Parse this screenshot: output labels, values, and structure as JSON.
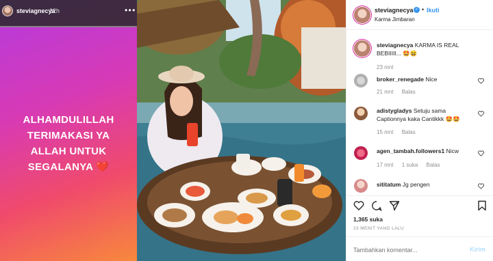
{
  "story": {
    "username": "steviagnecya",
    "time": "22h",
    "text_lines": [
      "ALHAMDULILLAH",
      "TERIMAKASI YA",
      "ALLAH UNTUK",
      "SEGALANYA"
    ],
    "heart": "❤️"
  },
  "header": {
    "username": "steviagnecya",
    "separator": "•",
    "follow_label": "Ikuti",
    "location": "Karma Jimbaran"
  },
  "caption": {
    "username": "steviagnecya",
    "text": "KARMA IS REAL BEBIIIII... 🤩😆",
    "time": "23 mnt"
  },
  "comments": [
    {
      "username": "broker_renegade",
      "text": "Nice",
      "time": "21 mnt",
      "reply": "Balas",
      "likes": ""
    },
    {
      "username": "adistygladys",
      "text": "Setuju sama Captionnya kaka Cantikkk 🤩🤩",
      "time": "15 mnt",
      "reply": "Balas",
      "likes": ""
    },
    {
      "username": "agen_tambah.followers1",
      "text": "Nicw",
      "time": "17 mnt",
      "reply": "Balas",
      "likes": "1 suka"
    },
    {
      "username": "sititatum",
      "text": "Jg pengen",
      "time": "",
      "reply": "",
      "likes": ""
    }
  ],
  "likes_count": "1,365 suka",
  "time_ago": "23 MENIT YANG LALU",
  "add_comment": {
    "placeholder": "Tambahkan komentar...",
    "post_label": "Kirim"
  },
  "colors": {
    "accent": "#3897f0",
    "text": "#262626",
    "muted": "#8e8e8e"
  }
}
